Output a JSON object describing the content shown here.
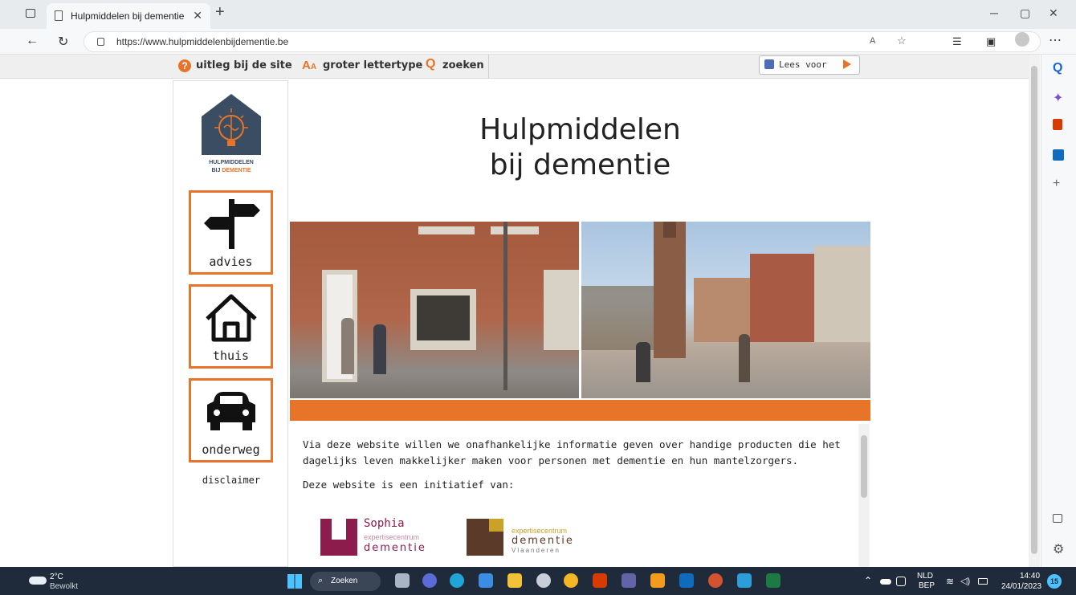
{
  "browser": {
    "tab_title": "Hulpmiddelen bij dementie",
    "url": "https://www.hulpmiddelenbijdementie.be",
    "new_tab_label": "+"
  },
  "sitebar": {
    "help_label": "uitleg bij de site",
    "font_label": "groter lettertype",
    "search_label": "zoeken",
    "read_label": "Lees voor"
  },
  "logo": {
    "line1": "HULPMIDDELEN",
    "line2a": "BIJ ",
    "line2b": "DEMENTIE"
  },
  "nav": {
    "advies": "advies",
    "thuis": "thuis",
    "onderweg": "onderweg",
    "disclaimer": "disclaimer"
  },
  "main": {
    "heading_line1": "Hulpmiddelen",
    "heading_line2": "bij dementie",
    "intro": "Via deze website willen we onafhankelijke informatie geven over handige producten die het dagelijks leven makkelijker maken voor personen met dementie en hun mantelzorgers.",
    "initiative": "Deze website is een initiatief van:",
    "partner1": {
      "name": "Sophia",
      "sub": "expertisecentrum",
      "brand": "dementie"
    },
    "partner2": {
      "sub": "expertisecentrum",
      "brand": "dementie",
      "region": "Vlaanderen"
    }
  },
  "taskbar": {
    "temp": "2°C",
    "weather": "Bewolkt",
    "search": "Zoeken",
    "lang1": "NLD",
    "lang2": "BEP",
    "time": "14:40",
    "date": "24/01/2023",
    "badge": "15"
  },
  "colors": {
    "accent_orange": "#e8742a",
    "logo_navy": "#3b4d63",
    "sophia_purple": "#8c1c4c",
    "partner2_brown": "#5c3a2a"
  }
}
